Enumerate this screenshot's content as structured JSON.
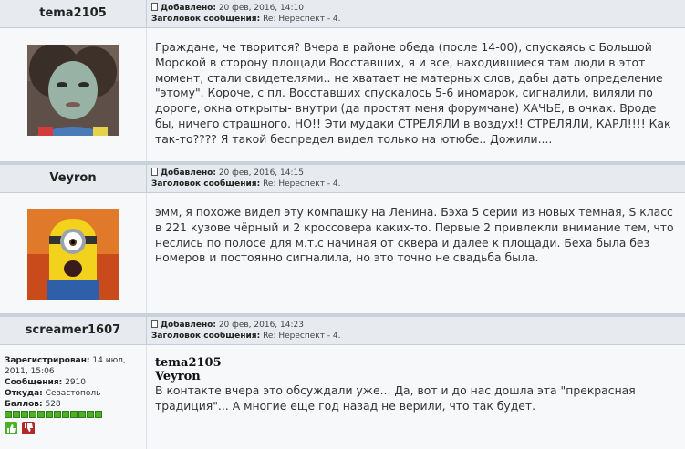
{
  "posts": [
    {
      "author": "tema2105",
      "added_label": "Добавлено:",
      "added_value": "20 фев, 2016, 14:10",
      "subject_label": "Заголовок сообщения:",
      "subject_value": "Re: Нереспект - 4.",
      "text": "Граждане, че творится? Вчера в районе обеда (после 14-00), спускаясь с Большой Морской в сторону площади Восставших, я и все, находившиеся там люди в этот момент, стали свидетелями.. не хватает не матерных слов, дабы дать определение \"этому\". Короче, с пл. Восставших спускалось 5-6 иномарок, сигналили, виляли по дороге, окна открыты- внутри (да простят меня форумчане) ХАЧЬЕ, в очках. Вроде бы, ничего страшного. НО!! Эти мудаки СТРЕЛЯЛИ в воздух!! СТРЕЛЯЛИ, КАРЛ!!!! Как так-то???? Я такой беспредел видел только на ютюбе.. Дожили...."
    },
    {
      "author": "Veyron",
      "added_label": "Добавлено:",
      "added_value": "20 фев, 2016, 14:15",
      "subject_label": "Заголовок сообщения:",
      "subject_value": "Re: Нереспект - 4.",
      "text": "эмм, я похоже видел эту компашку на Ленина. Бэха 5 серии из новых темная, S класс в 221 кузове чёрный и 2 кроссовера каких-то. Первые 2 привлекли внимание тем, что неслись по полосе для м.т.с начиная от сквера и далее к площади. Беха была без номеров и постоянно сигналила, но это точно не свадьба была."
    },
    {
      "author": "screamer1607",
      "added_label": "Добавлено:",
      "added_value": "20 фев, 2016, 14:23",
      "subject_label": "Заголовок сообщения:",
      "subject_value": "Re: Нереспект - 4.",
      "quote_name_1": "tema2105",
      "quote_name_2": "Veyron",
      "text": "В контакте вчера это обсуждали уже... Да, вот и до нас дошла эта \"прекрасная традиция\"... А многие еще год назад не верили, что так будет.",
      "profile": {
        "registered_label": "Зарегистрирован:",
        "registered_value": "14 июл, 2011, 15:06",
        "messages_label": "Сообщения:",
        "messages_value": "2910",
        "from_label": "Откуда:",
        "from_value": "Севастополь",
        "points_label": "Баллов:",
        "points_value": "528",
        "stars": 12
      }
    }
  ],
  "colors": {
    "header_bg": "#e7ebef",
    "body_bg": "#f6f8f9",
    "separator": "#c8d2db",
    "rating_green": "#4caf28"
  },
  "icons": [
    "document-icon",
    "thumbs-up-icon",
    "thumbs-down-icon"
  ]
}
